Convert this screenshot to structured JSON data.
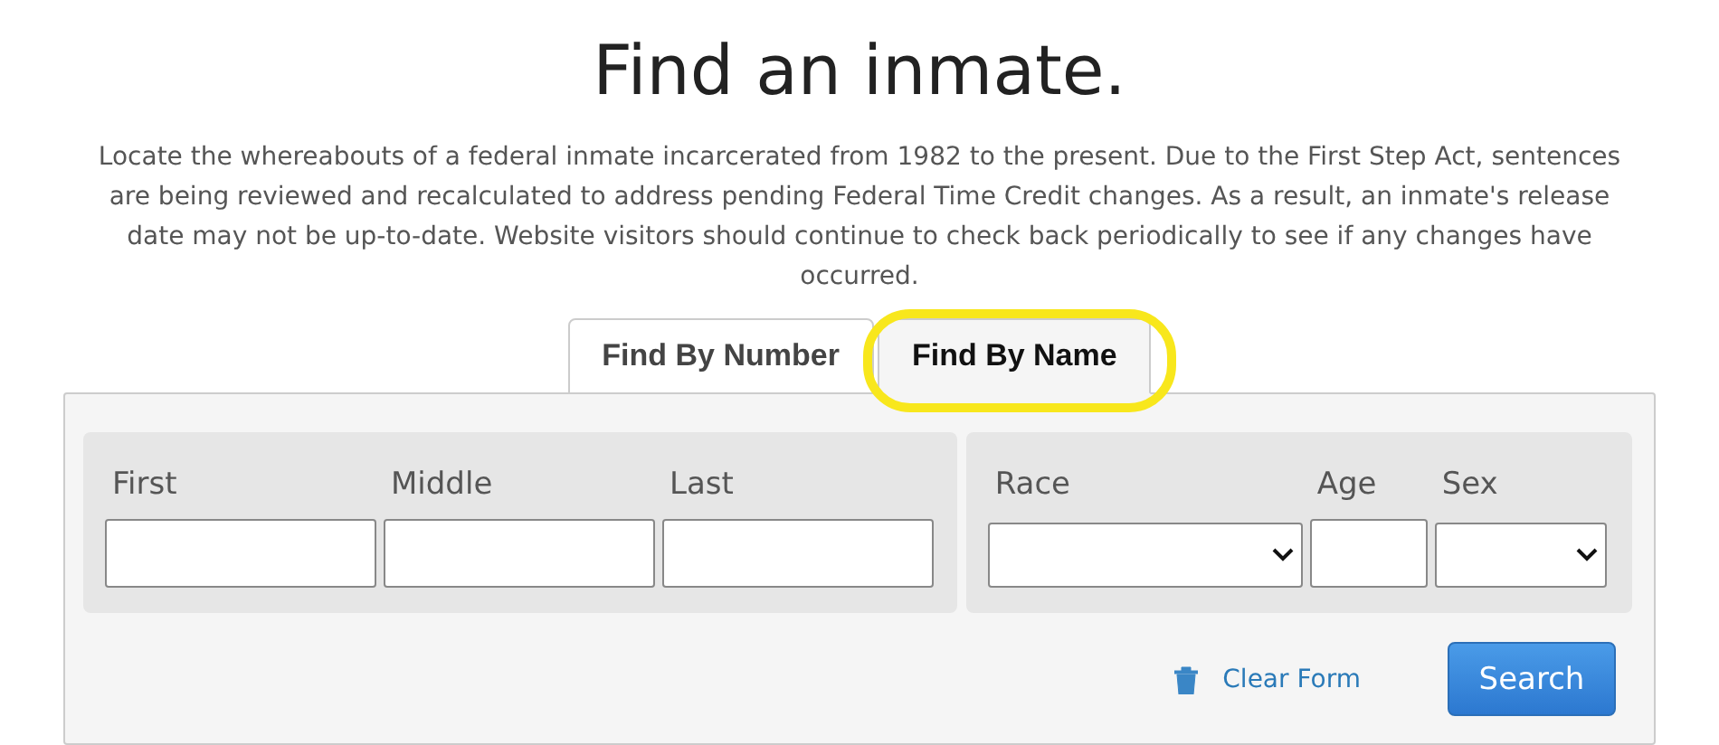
{
  "title": "Find an inmate.",
  "intro": "Locate the whereabouts of a federal inmate incarcerated from 1982 to the present. Due to the First Step Act, sentences are being reviewed and recalculated to address pending Federal Time Credit changes. As a result, an inmate's release date may not be up-to-date. Website visitors should continue to check back periodically to see if any changes have occurred.",
  "tabs": [
    {
      "label": "Find By Number",
      "selected": false,
      "highlighted": false
    },
    {
      "label": "Find By Name",
      "selected": true,
      "highlighted": true
    }
  ],
  "name_fields": [
    {
      "label": "First",
      "kind": "text"
    },
    {
      "label": "Middle",
      "kind": "text"
    },
    {
      "label": "Last",
      "kind": "text"
    }
  ],
  "detail_fields": [
    {
      "label": "Race",
      "kind": "select"
    },
    {
      "label": "Age",
      "kind": "text"
    },
    {
      "label": "Sex",
      "kind": "select"
    }
  ],
  "clear_link": "Clear Form",
  "search_button": "Search"
}
